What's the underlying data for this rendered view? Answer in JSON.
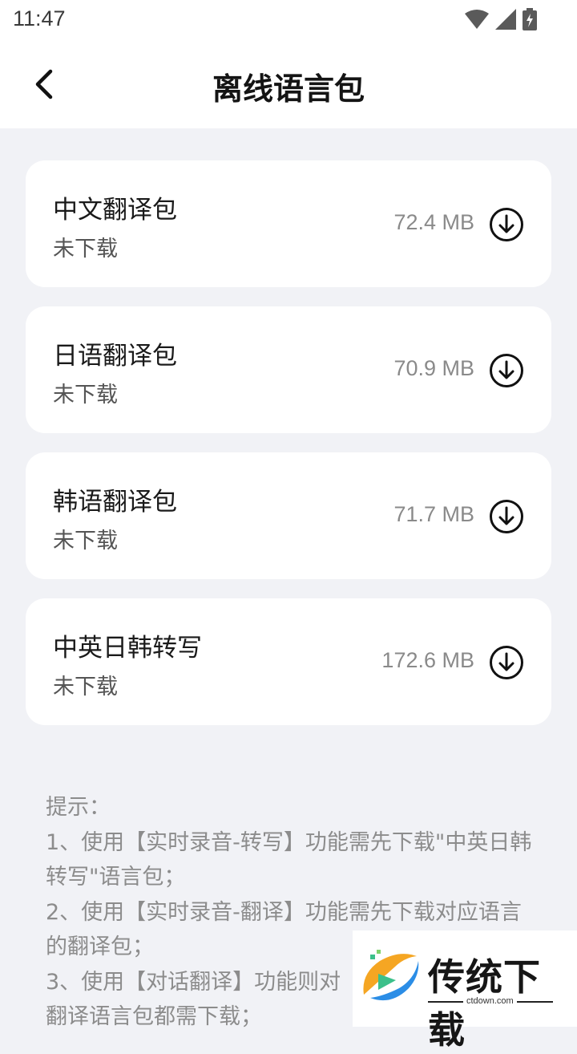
{
  "status_bar": {
    "time": "11:47"
  },
  "header": {
    "title": "离线语言包"
  },
  "packages": [
    {
      "name": "中文翻译包",
      "status": "未下载",
      "size": "72.4 MB"
    },
    {
      "name": "日语翻译包",
      "status": "未下载",
      "size": "70.9 MB"
    },
    {
      "name": "韩语翻译包",
      "status": "未下载",
      "size": "71.7 MB"
    },
    {
      "name": "中英日韩转写",
      "status": "未下载",
      "size": "172.6 MB"
    }
  ],
  "tips": {
    "title": "提示：",
    "line1": "1、使用【实时录音-转写】功能需先下载\"中英日韩转写\"语言包；",
    "line2": "2、使用【实时录音-翻译】功能需先下载对应语言的翻译包；",
    "line3": "3、使用【对话翻译】功能则对",
    "line4": "翻译语言包都需下载；"
  },
  "watermark": {
    "text": "传统下载",
    "url": "ctdown.com"
  },
  "icons": {
    "back": "chevron-left-icon",
    "download": "download-circle-icon",
    "wifi": "wifi-icon",
    "signal": "signal-icon",
    "battery": "battery-charging-icon"
  }
}
